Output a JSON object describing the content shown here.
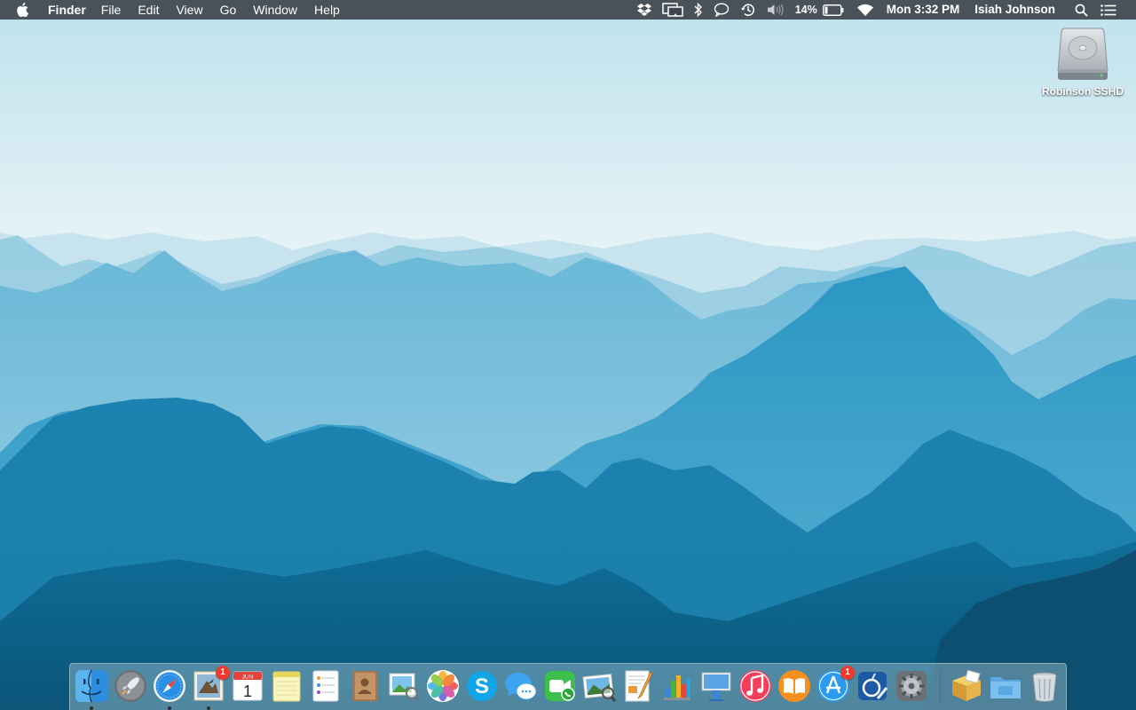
{
  "menubar": {
    "apple_icon": "apple-logo-icon",
    "app_name": "Finder",
    "menus": [
      "File",
      "Edit",
      "View",
      "Go",
      "Window",
      "Help"
    ],
    "status_icons": [
      "dropbox-icon",
      "airplay-icon",
      "bluetooth-icon",
      "notification-bubble-icon",
      "time-machine-icon",
      "volume-icon"
    ],
    "battery_percent": "14%",
    "clock": "Mon 3:32 PM",
    "user": "Isiah Johnson",
    "spotlight_icon": "search-icon",
    "notification_center_icon": "list-icon"
  },
  "desktop": {
    "drive_label": "Robinson SSHD"
  },
  "dock": {
    "apps": [
      {
        "name": "finder",
        "icon": "finder-icon",
        "running": true
      },
      {
        "name": "launchpad",
        "icon": "launchpad-rocket-icon"
      },
      {
        "name": "safari",
        "icon": "safari-compass-icon",
        "running": true
      },
      {
        "name": "mail",
        "icon": "mail-stamp-icon",
        "badge": "1",
        "running": true
      },
      {
        "name": "calendar",
        "icon": "calendar-icon",
        "month": "JUN",
        "day": "1"
      },
      {
        "name": "notes",
        "icon": "notes-icon"
      },
      {
        "name": "reminders",
        "icon": "reminders-icon"
      },
      {
        "name": "contacts",
        "icon": "contacts-book-icon"
      },
      {
        "name": "preview",
        "icon": "preview-icon"
      },
      {
        "name": "photos",
        "icon": "photos-flower-icon"
      },
      {
        "name": "skype",
        "icon": "skype-icon"
      },
      {
        "name": "messages",
        "icon": "messages-bubble-icon"
      },
      {
        "name": "facetime",
        "icon": "facetime-icon"
      },
      {
        "name": "iphoto",
        "icon": "iphoto-icon"
      },
      {
        "name": "pages",
        "icon": "pages-icon"
      },
      {
        "name": "numbers",
        "icon": "numbers-chart-icon"
      },
      {
        "name": "keynote",
        "icon": "keynote-podium-icon"
      },
      {
        "name": "itunes",
        "icon": "itunes-note-icon"
      },
      {
        "name": "ibooks",
        "icon": "ibooks-icon"
      },
      {
        "name": "app-store",
        "icon": "app-store-icon",
        "badge": "1"
      },
      {
        "name": "xcode-instruments",
        "icon": "instruments-icon"
      },
      {
        "name": "system-preferences",
        "icon": "gear-icon"
      }
    ],
    "stacks": [
      {
        "name": "package-stack",
        "icon": "package-box-icon"
      },
      {
        "name": "folder-stack",
        "icon": "folder-icon"
      },
      {
        "name": "trash",
        "icon": "trash-icon"
      }
    ],
    "calendar_month": "JUN",
    "calendar_day": "1",
    "mail_badge": "1",
    "appstore_badge": "1"
  },
  "colors": {
    "menubar_bg": "#40464e",
    "sky_top": "#bfe2ee",
    "sky_horizon": "#eef7f9",
    "mountain_far": "#a9d6e6",
    "mountain_mid": "#5fb3d4",
    "mountain_near": "#1c8ab6",
    "mountain_front": "#0f5f86",
    "badge_red": "#ef3a2e"
  }
}
